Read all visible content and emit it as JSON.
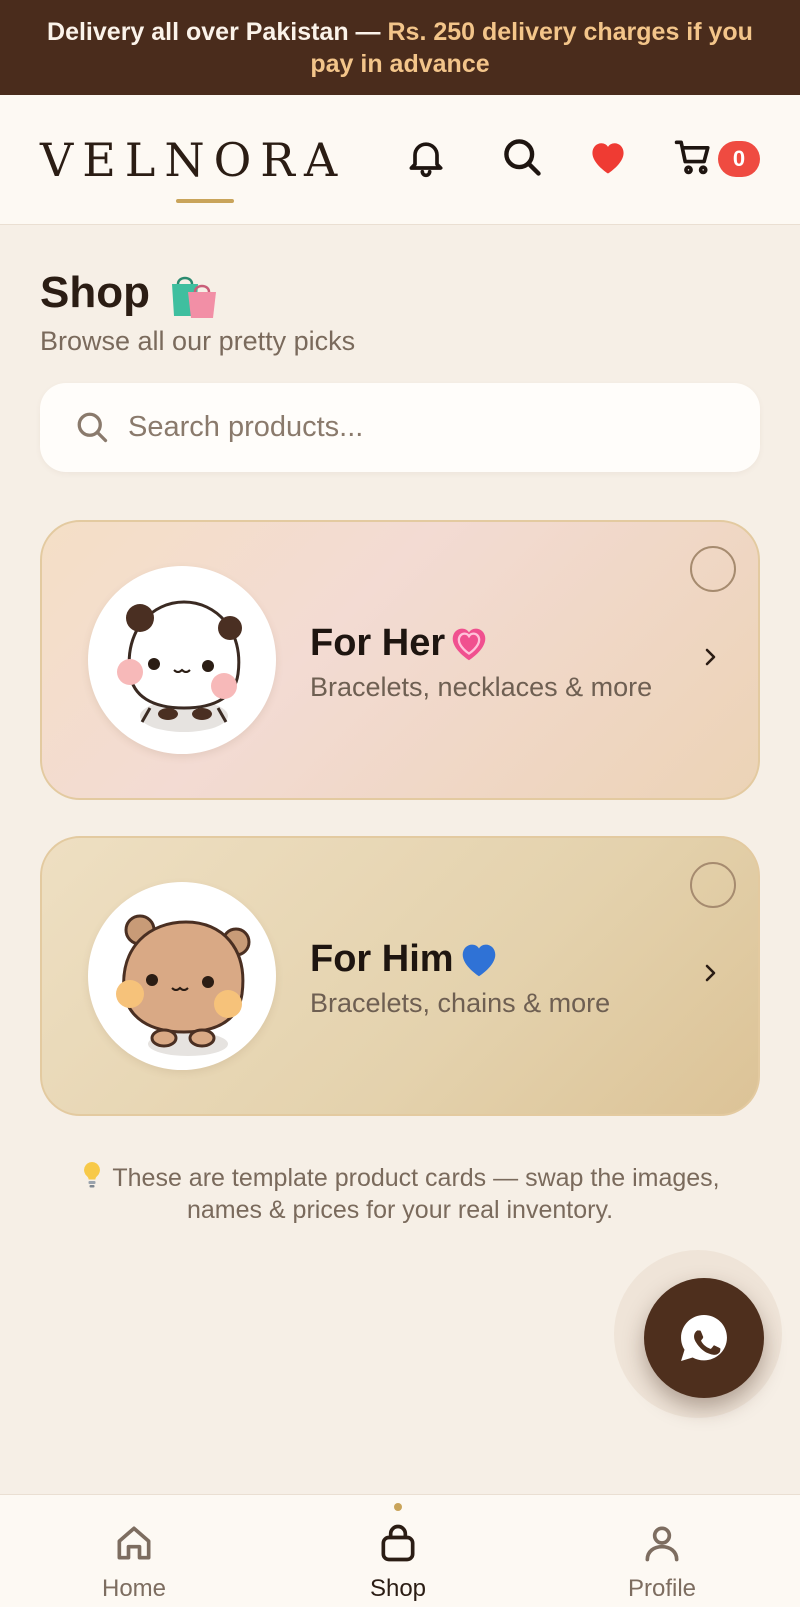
{
  "announcement": {
    "text_prefix": "Delivery all over Pakistan — ",
    "text_highlight": "Rs. 250 delivery charges if you pay in advance"
  },
  "header": {
    "logo": "VELNORA",
    "cart_count": "0",
    "icons": [
      "bell-icon",
      "search-icon",
      "heart-icon",
      "cart-icon"
    ]
  },
  "page": {
    "title": "Shop",
    "title_emoji": "shopping-bags-icon",
    "subtitle": "Browse all our pretty picks"
  },
  "search": {
    "placeholder": "Search products...",
    "value": ""
  },
  "categories": [
    {
      "title": "For Her",
      "emoji": "pink-heart-icon",
      "description": "Bracelets, necklaces & more",
      "mascot": "white-bear-mascot"
    },
    {
      "title": "For Him",
      "emoji": "blue-heart-icon",
      "description": "Bracelets, chains & more",
      "mascot": "brown-bear-mascot"
    }
  ],
  "note": {
    "icon": "lightbulb-icon",
    "text": "These are template product cards — swap the images, names & prices for your real inventory."
  },
  "fab": {
    "icon": "whatsapp-icon"
  },
  "bottom_nav": {
    "items": [
      {
        "label": "Home",
        "icon": "home-icon"
      },
      {
        "label": "Shop",
        "icon": "bag-icon",
        "active": true
      },
      {
        "label": "Profile",
        "icon": "user-icon"
      }
    ]
  },
  "colors": {
    "brown_dark": "#4a2c1c",
    "gold_accent": "#c9a45a",
    "highlight": "#f3c58a",
    "badge_red": "#ef4b41",
    "background": "#f6efe6"
  }
}
